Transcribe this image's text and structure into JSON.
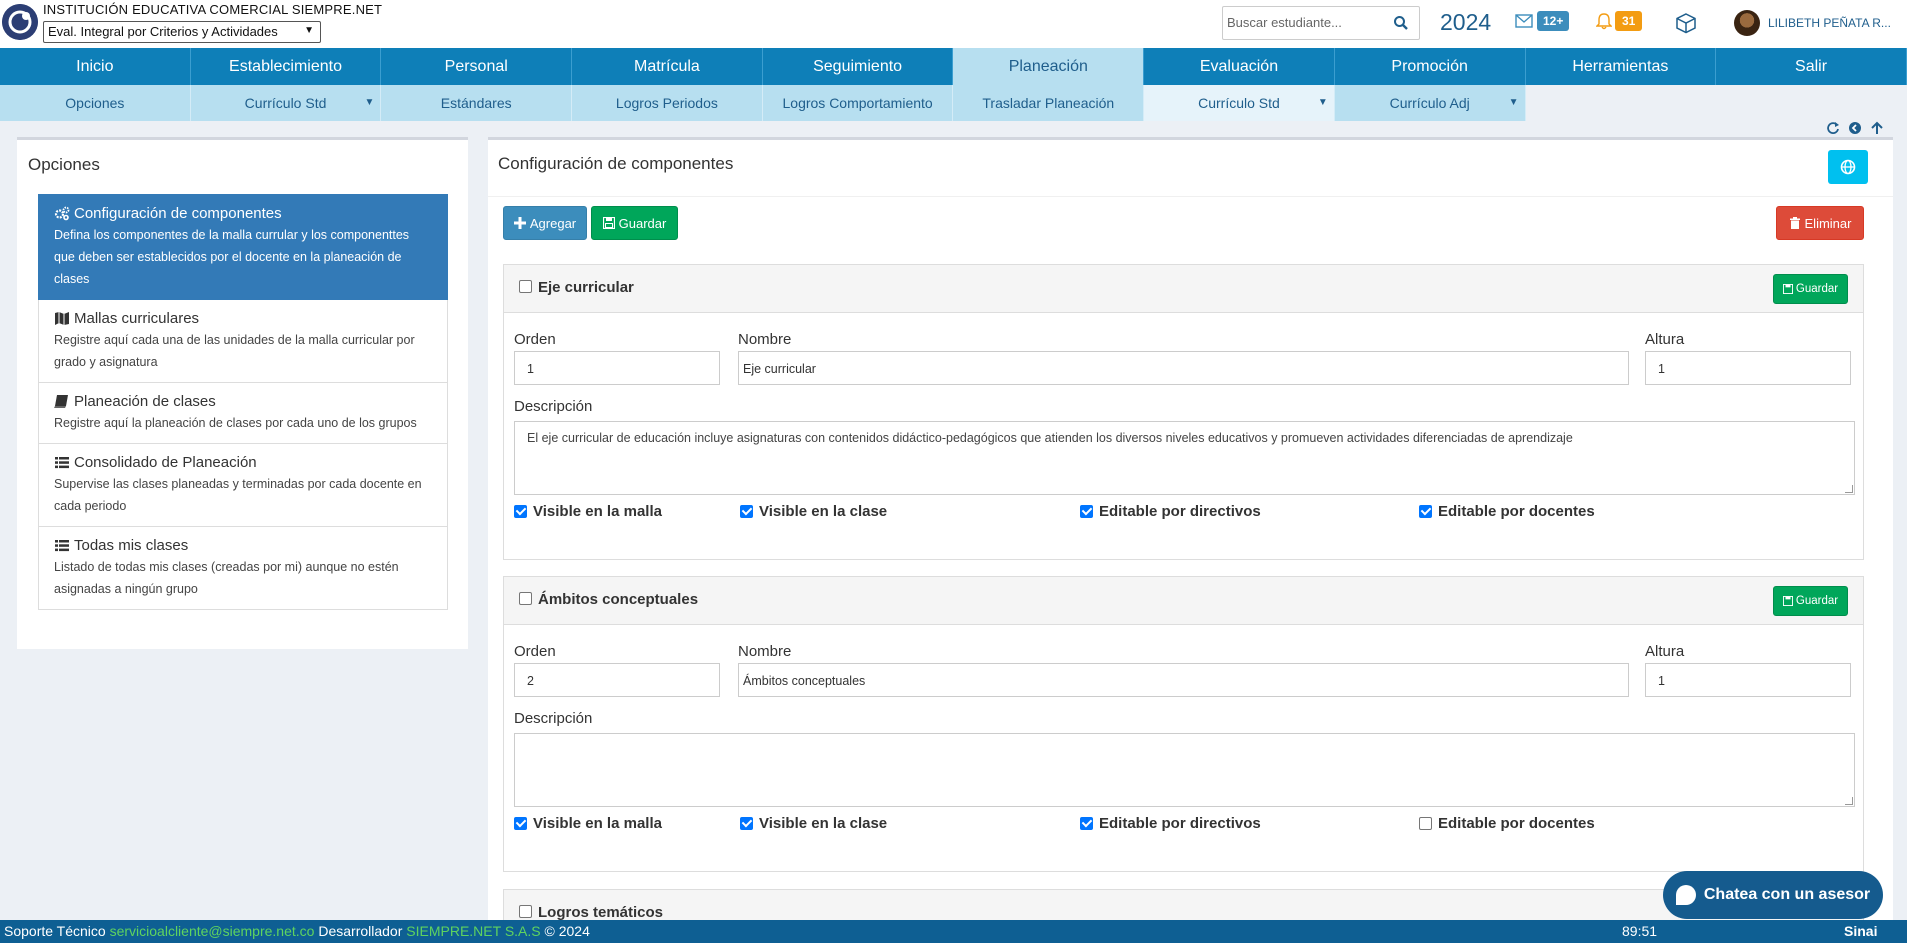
{
  "header": {
    "institution": "INSTITUCIÓN EDUCATIVA COMERCIAL SIEMPRE.NET",
    "mode": "Eval. Integral por Criterios y Actividades",
    "search_placeholder": "Buscar estudiante...",
    "year": "2024",
    "messages_badge": "12+",
    "notifications_badge": "31",
    "user": "LILIBETH PEÑATA R..."
  },
  "main_nav": [
    "Inicio",
    "Establecimiento",
    "Personal",
    "Matrícula",
    "Seguimiento",
    "Planeación",
    "Evaluación",
    "Promoción",
    "Herramientas",
    "Salir"
  ],
  "sub_nav": [
    "Opciones",
    "Currículo Std",
    "Estándares",
    "Logros Periodos",
    "Logros Comportamiento",
    "Trasladar Planeación",
    "Currículo Std",
    "Currículo Adj"
  ],
  "left": {
    "title": "Opciones",
    "options": [
      {
        "title": "Configuración de componentes",
        "desc": "Defina los componentes de la malla currular y los componenttes que deben ser establecidos por el docente en la planeación de clases",
        "icon": "gears-icon"
      },
      {
        "title": "Mallas curriculares",
        "desc": "Registre aquí cada una de las unidades de la malla curricular por grado y asignatura",
        "icon": "map-icon"
      },
      {
        "title": "Planeación de clases",
        "desc": "Registre aquí la planeación de clases por cada uno de los grupos",
        "icon": "book-icon"
      },
      {
        "title": "Consolidado de Planeación",
        "desc": "Supervise las clases planeadas y terminadas por cada docente en cada periodo",
        "icon": "list-icon"
      },
      {
        "title": "Todas mis clases",
        "desc": "Listado de todas mis clases (creadas por mi) aunque no estén asignadas a ningún grupo",
        "icon": "list-icon"
      }
    ]
  },
  "right": {
    "title": "Configuración de componentes",
    "add_label": "Agregar",
    "save_label": "Guardar",
    "delete_label": "Eliminar",
    "labels": {
      "order": "Orden",
      "name": "Nombre",
      "height": "Altura",
      "description": "Descripción"
    },
    "checkbox_labels": [
      "Visible en la malla",
      "Visible en la clase",
      "Editable por directivos",
      "Editable por docentes"
    ],
    "components": [
      {
        "title": "Eje curricular",
        "order": "1",
        "name": "Eje curricular",
        "height": "1",
        "description": "El eje curricular de educación incluye asignaturas con contenidos didáctico-pedagógicos que atienden los diversos niveles educativos y promueven actividades diferenciadas de aprendizaje",
        "checks": [
          true,
          true,
          true,
          true
        ]
      },
      {
        "title": "Ámbitos conceptuales",
        "order": "2",
        "name": "Ámbitos conceptuales",
        "height": "1",
        "description": "",
        "checks": [
          true,
          true,
          true,
          false
        ]
      },
      {
        "title": "Logros temáticos"
      }
    ]
  },
  "chat_label": "Chatea con un asesor",
  "footer": {
    "support_label": "Soporte Técnico",
    "support_email": "servicioalcliente@siempre.net.co",
    "developer_label": "Desarrollador",
    "developer": "SIEMPRE.NET S.A.S",
    "copyright": "© 2024",
    "time": "89:51",
    "brand": "Sinai"
  }
}
